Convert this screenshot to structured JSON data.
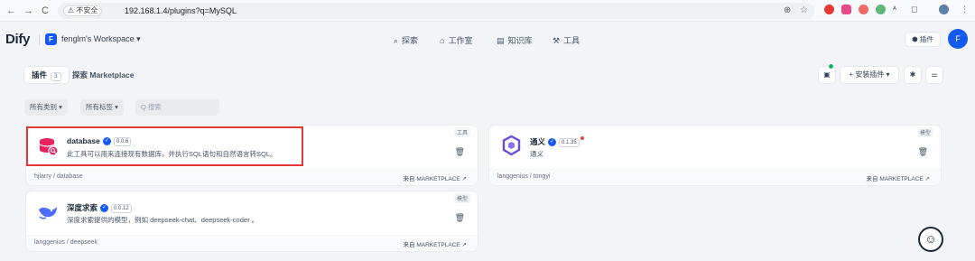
{
  "browser": {
    "back": "←",
    "forward": "→",
    "reload": "C",
    "security_label": "⚠ 不安全",
    "url": "192.168.1.4/plugins?q=MySQL"
  },
  "header": {
    "logo": "Dify",
    "workspace_initial": "F",
    "workspace_name": "fenglm's Workspace ▾",
    "nav": [
      {
        "icon": "explore-icon",
        "glyph": "⌕",
        "label": "探索"
      },
      {
        "icon": "studio-icon",
        "glyph": "⌂",
        "label": "工作室"
      },
      {
        "icon": "knowledge-icon",
        "glyph": "▤",
        "label": "知识库"
      },
      {
        "icon": "tools-icon",
        "glyph": "⚒",
        "label": "工具"
      }
    ],
    "plugin_button": "插件",
    "user_initial": "F"
  },
  "tabs": {
    "installed_label": "插件",
    "installed_count": "3",
    "marketplace_label": "探索 Marketplace"
  },
  "toolbar": {
    "install_label": "+ 安装插件 ▾"
  },
  "filters": {
    "category": "所有类别 ▾",
    "tags": "所有标签 ▾",
    "search_placeholder": "Q 搜索"
  },
  "plugins": [
    {
      "name": "database",
      "version": "0.0.6",
      "description": "此工具可以用来连接现有数据库，并执行SQL语句和自然语言转SQL。",
      "author": "hjlarry / database",
      "category": "工具",
      "source": "来自 MARKETPLACE ↗"
    },
    {
      "name": "通义",
      "version": "0.1.35",
      "description": "通义",
      "author": "langgenius / tongyi",
      "category": "模型",
      "source": "来自 MARKETPLACE ↗"
    },
    {
      "name": "深度求索",
      "version": "0.0.12",
      "description": "深度求索提供的模型，例如 deepseek-chat、deepseek-coder 。",
      "author": "langgenius / deepseek",
      "category": "模型",
      "source": "来自 MARKETPLACE ↗"
    }
  ],
  "colors": {
    "accent": "#155aef",
    "highlight": "#e53935",
    "verified": "#155aef"
  }
}
